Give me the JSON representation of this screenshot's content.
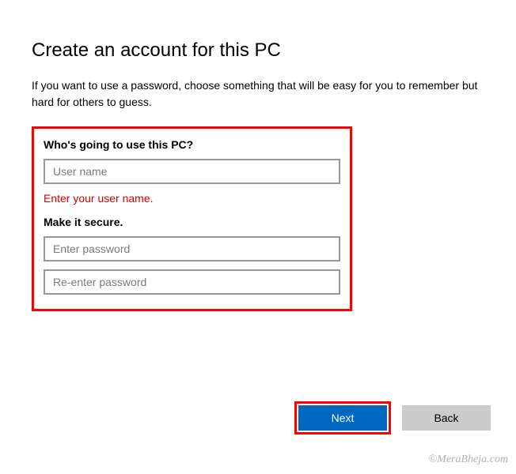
{
  "page": {
    "title": "Create an account for this PC",
    "description": "If you want to use a password, choose something that will be easy for you to remember but hard for others to guess."
  },
  "form": {
    "user_section_label": "Who's going to use this PC?",
    "username_placeholder": "User name",
    "username_value": "",
    "username_error": "Enter your user name.",
    "secure_section_label": "Make it secure.",
    "password_placeholder": "Enter password",
    "password_value": "",
    "reenter_placeholder": "Re-enter password",
    "reenter_value": ""
  },
  "buttons": {
    "next": "Next",
    "back": "Back"
  },
  "watermark": "©MeraBheja.com"
}
